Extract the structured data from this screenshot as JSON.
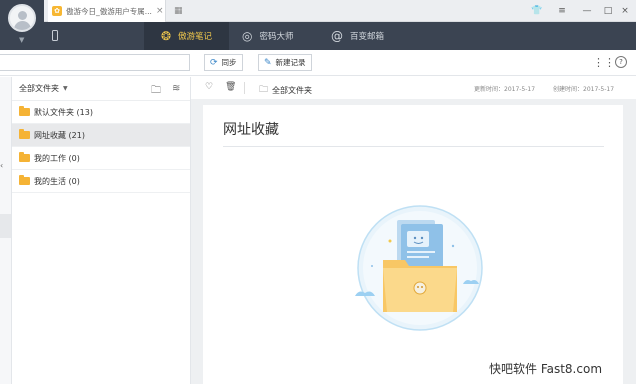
{
  "titlebar": {
    "tab_title": "傲游今日_傲游用户专属...",
    "close_glyph": "×",
    "grid_glyph": "▦",
    "win_controls": {
      "skin": "👕",
      "menu": "≡",
      "minimize": "—",
      "maximize": "□",
      "close": "×"
    }
  },
  "nav": {
    "items": [
      {
        "label": "傲游笔记",
        "icon": "notes-icon",
        "active": true
      },
      {
        "label": "密码大师",
        "icon": "fingerprint-icon",
        "active": false
      },
      {
        "label": "百变邮箱",
        "icon": "mail-icon",
        "active": false
      }
    ]
  },
  "toolbar": {
    "search_placeholder": "",
    "sync_label": "同步",
    "new_record_label": "新建记录",
    "help_glyph": "?"
  },
  "folders": {
    "header_label": "全部文件夹",
    "items": [
      {
        "label": "默认文件夹 (13)",
        "selected": false
      },
      {
        "label": "网址收藏 (21)",
        "selected": true
      },
      {
        "label": "我的工作 (0)",
        "selected": false
      },
      {
        "label": "我的生活 (0)",
        "selected": false
      }
    ]
  },
  "content": {
    "path_label": "全部文件夹",
    "updated": "更新时间：2017-5-17",
    "created": "创建时间：2017-5-17",
    "note_title": "网址收藏"
  },
  "watermark": "快吧软件 Fast8.com",
  "colors": {
    "nav_bg": "#3b4452",
    "nav_active_bg": "#2e3642",
    "accent_yellow": "#f2c94c",
    "folder_yellow": "#f5b335",
    "sync_blue": "#3a86c8"
  }
}
